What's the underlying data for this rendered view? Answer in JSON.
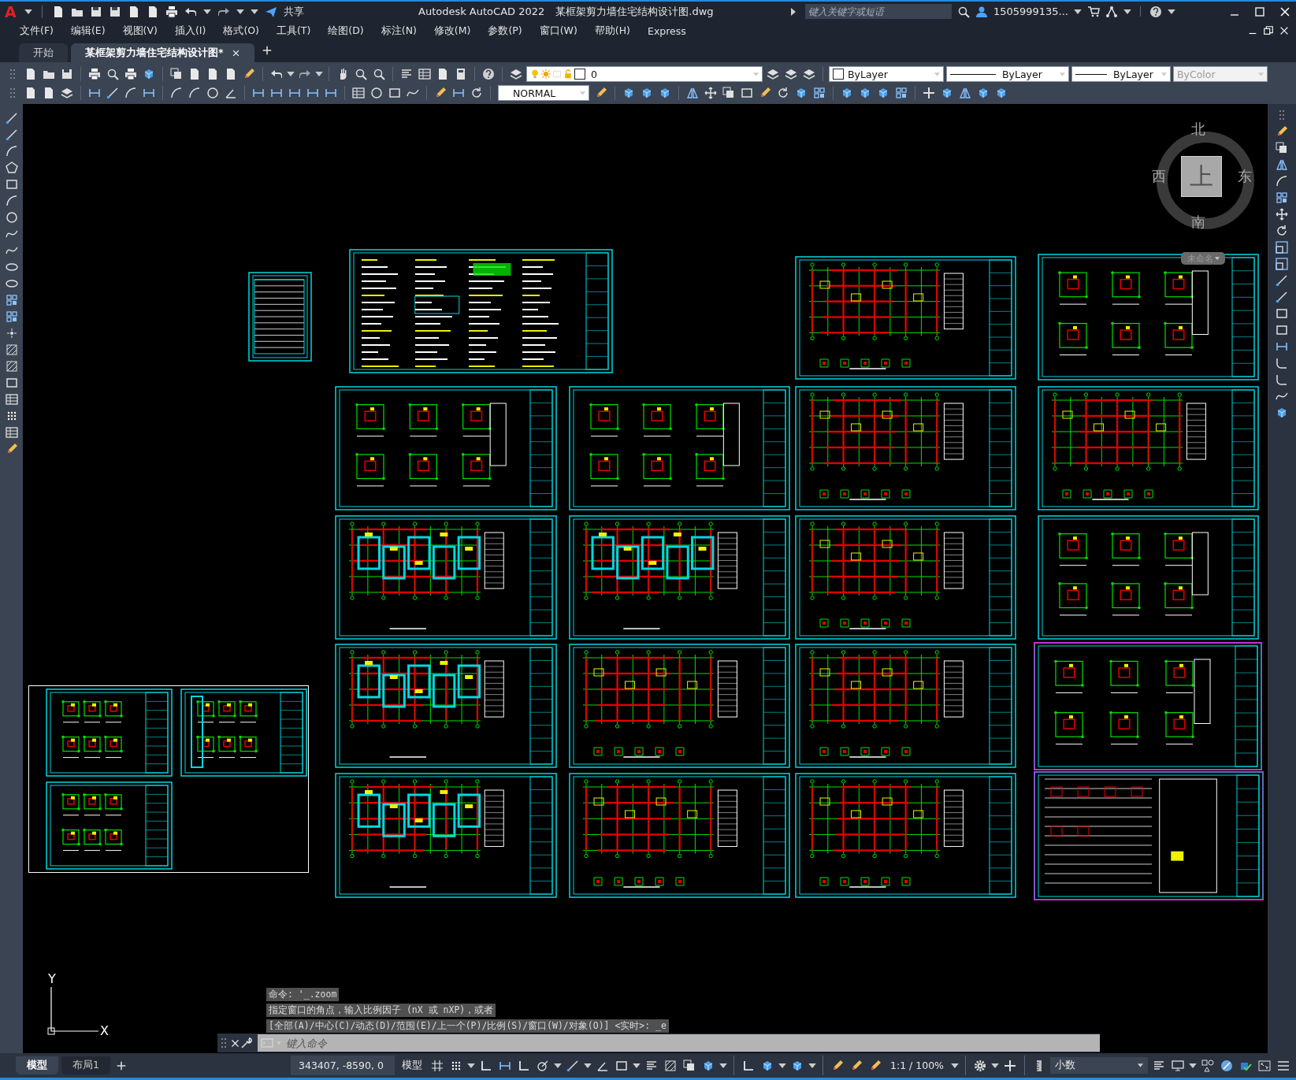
{
  "title_bar": {
    "logo": "A",
    "share": "共享",
    "app_title": "Autodesk AutoCAD 2022",
    "file_name": "某框架剪力墙住宅结构设计图.dwg",
    "search": {
      "placeholder": "键入关键字或短语"
    },
    "user": "1505999135..."
  },
  "menu": [
    "文件(F)",
    "编辑(E)",
    "视图(V)",
    "插入(I)",
    "格式(O)",
    "工具(T)",
    "绘图(D)",
    "标注(N)",
    "修改(M)",
    "参数(P)",
    "窗口(W)",
    "帮助(H)",
    "Express"
  ],
  "doc_tabs": [
    {
      "label": "开始",
      "selected": false
    },
    {
      "label": "某框架剪力墙住宅结构设计图*",
      "selected": true
    }
  ],
  "properties": {
    "layer": "0",
    "text_style": "NORMAL",
    "color_control": "ByLayer",
    "linetype": "ByLayer",
    "lineweight": "ByLayer",
    "plot_style": {
      "value": "ByColor",
      "disabled": true
    }
  },
  "view_cube": {
    "north": "北",
    "south": "南",
    "east": "东",
    "west": "西",
    "face": "上",
    "view_name": "未命名"
  },
  "ucs": {
    "x": "X",
    "y": "Y"
  },
  "sheets": [
    {
      "kind": "table",
      "selected": false
    },
    {
      "kind": "notes",
      "selected": false
    },
    {
      "kind": "plan",
      "selected": false
    },
    {
      "kind": "details",
      "selected": false
    },
    {
      "kind": "details",
      "selected": false
    },
    {
      "kind": "details",
      "selected": false
    },
    {
      "kind": "plan",
      "selected": false
    },
    {
      "kind": "plan",
      "selected": false
    },
    {
      "kind": "wallplan",
      "selected": false
    },
    {
      "kind": "wallplan",
      "selected": false
    },
    {
      "kind": "plan",
      "selected": false
    },
    {
      "kind": "details",
      "selected": false
    },
    {
      "kind": "wallplan",
      "selected": false
    },
    {
      "kind": "plan",
      "selected": false
    },
    {
      "kind": "plan",
      "selected": false
    },
    {
      "kind": "details",
      "selected": true
    },
    {
      "kind": "wallplan",
      "selected": false
    },
    {
      "kind": "plan",
      "selected": false
    },
    {
      "kind": "plan",
      "selected": false
    },
    {
      "kind": "table",
      "selected": true
    },
    {
      "kind": "details",
      "selected": false
    },
    {
      "kind": "section",
      "selected": false
    },
    {
      "kind": "details",
      "selected": false
    }
  ],
  "command_line": {
    "history": [
      "命令: '_.zoom",
      "指定窗口的角点，输入比例因子 (nX 或 nXP)，或者",
      "[全部(A)/中心(C)/动态(D)/范围(E)/上一个(P)/比例(S)/窗口(W)/对象(O)] <实时>: _e"
    ],
    "placeholder": "键入命令"
  },
  "layout_tabs": [
    {
      "label": "模型",
      "selected": true
    },
    {
      "label": "布局1",
      "selected": false
    }
  ],
  "status_bar": {
    "coordinates": "343407, -8590, 0",
    "space": "模型",
    "scale": "1:1 / 100%",
    "units": "小数"
  }
}
